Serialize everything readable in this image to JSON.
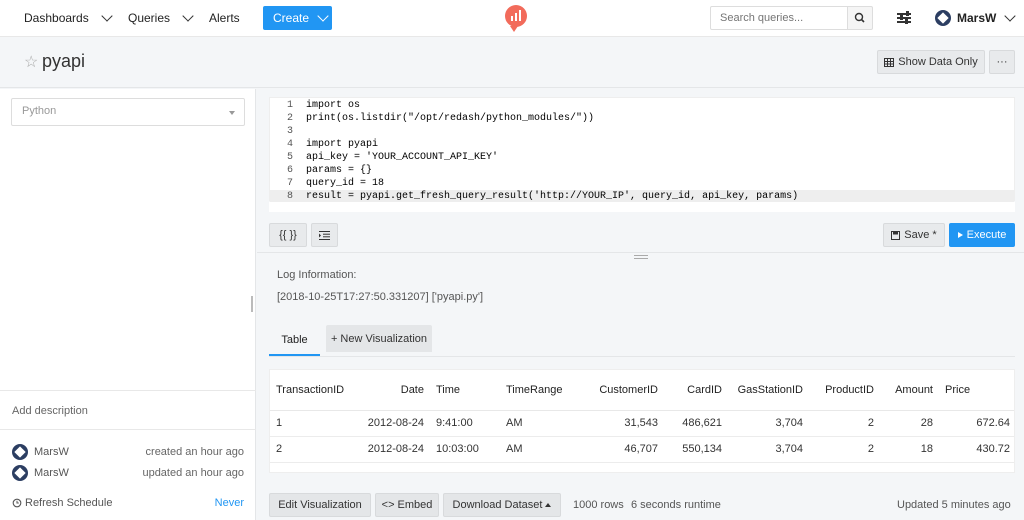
{
  "nav": {
    "dashboards": "Dashboards",
    "queries": "Queries",
    "alerts": "Alerts",
    "create": "Create",
    "search_placeholder": "Search queries...",
    "user": "MarsW"
  },
  "query": {
    "title": "pyapi",
    "show_data_only": "Show Data Only",
    "more": "···"
  },
  "left": {
    "data_source": "Python",
    "add_description": "Add description",
    "created_user": "MarsW",
    "created_text": "created an hour ago",
    "updated_user": "MarsW",
    "updated_text": "updated an hour ago",
    "refresh_label": "Refresh Schedule",
    "refresh_value": "Never"
  },
  "editor": {
    "lines": [
      {
        "n": "1",
        "code": "import os"
      },
      {
        "n": "2",
        "code": "print(os.listdir(\"/opt/redash/python_modules/\"))"
      },
      {
        "n": "3",
        "code": ""
      },
      {
        "n": "4",
        "code": "import pyapi"
      },
      {
        "n": "5",
        "code": "api_key = 'YOUR_ACCOUNT_API_KEY'"
      },
      {
        "n": "6",
        "code": "params = {}"
      },
      {
        "n": "7",
        "code": "query_id = 18"
      },
      {
        "n": "8",
        "code": "result = pyapi.get_fresh_query_result('http://YOUR_IP', query_id, api_key, params)"
      }
    ],
    "format_btn": "{{ }}",
    "save": "Save *",
    "execute": "Execute"
  },
  "results": {
    "log_label": "Log Information:",
    "log_line": "[2018-10-25T17:27:50.331207] ['pyapi.py']",
    "tab_table": "Table",
    "tab_new_viz": "+ New Visualization",
    "columns": [
      "TransactionID",
      "Date",
      "Time",
      "TimeRange",
      "CustomerID",
      "CardID",
      "GasStationID",
      "ProductID",
      "Amount",
      "Price"
    ],
    "rows": [
      [
        "1",
        "2012-08-24",
        "9:41:00",
        "AM",
        "31,543",
        "486,621",
        "3,704",
        "2",
        "28",
        "672.64"
      ],
      [
        "2",
        "2012-08-24",
        "10:03:00",
        "AM",
        "46,707",
        "550,134",
        "3,704",
        "2",
        "18",
        "430.72"
      ]
    ]
  },
  "footer": {
    "edit_viz": "Edit Visualization",
    "embed": "Embed",
    "download": "Download Dataset",
    "rows": "1000 rows",
    "runtime": "6 seconds runtime",
    "updated": "Updated 5 minutes ago"
  }
}
